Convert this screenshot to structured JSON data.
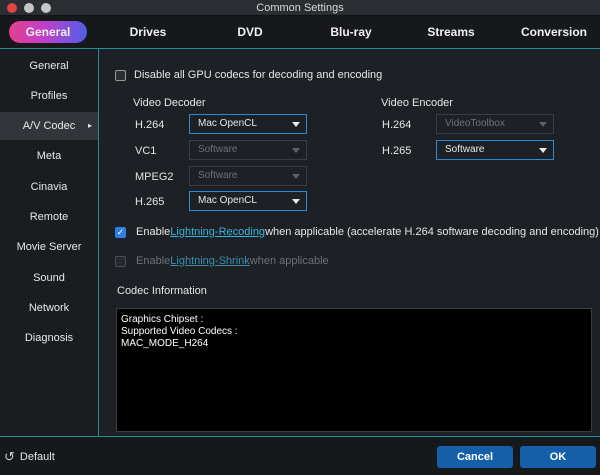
{
  "window": {
    "title": "Common Settings"
  },
  "tabs": [
    {
      "label": "General"
    },
    {
      "label": "Drives"
    },
    {
      "label": "DVD"
    },
    {
      "label": "Blu-ray"
    },
    {
      "label": "Streams"
    },
    {
      "label": "Conversion"
    }
  ],
  "sidebar": {
    "items": [
      {
        "label": "General"
      },
      {
        "label": "Profiles"
      },
      {
        "label": "A/V Codec"
      },
      {
        "label": "Meta"
      },
      {
        "label": "Cinavia"
      },
      {
        "label": "Remote"
      },
      {
        "label": "Movie Server"
      },
      {
        "label": "Sound"
      },
      {
        "label": "Network"
      },
      {
        "label": "Diagnosis"
      }
    ],
    "active_arrow": "▸"
  },
  "codec": {
    "disable_gpu_label": "Disable all GPU codecs for decoding and encoding",
    "decoder": {
      "heading": "Video Decoder",
      "rows": [
        {
          "label": "H.264",
          "value": "Mac OpenCL"
        },
        {
          "label": "VC1",
          "value": "Software"
        },
        {
          "label": "MPEG2",
          "value": "Software"
        },
        {
          "label": "H.265",
          "value": "Mac OpenCL"
        }
      ]
    },
    "encoder": {
      "heading": "Video Encoder",
      "rows": [
        {
          "label": "H.264",
          "value": "VideoToolbox"
        },
        {
          "label": "H.265",
          "value": "Software"
        }
      ]
    },
    "recode": {
      "prefix": "Enable ",
      "link": "Lightning-Recoding",
      "suffix": " when applicable (accelerate H.264 software decoding and encoding)",
      "check": "✓"
    },
    "shrink": {
      "prefix": "Enable ",
      "link": "Lightning-Shrink",
      "suffix": " when applicable"
    },
    "info": {
      "heading": "Codec Information",
      "lines": [
        "Graphics Chipset :",
        "Supported Video Codecs :",
        "MAC_MODE_H264"
      ]
    }
  },
  "footer": {
    "default_icon": "↺",
    "default_label": "Default",
    "cancel_label": "Cancel",
    "ok_label": "OK"
  },
  "colors": {
    "accent": "#1f8f9a",
    "button": "#155fa8",
    "link": "#3ab3e0",
    "close": "#e0443e"
  }
}
